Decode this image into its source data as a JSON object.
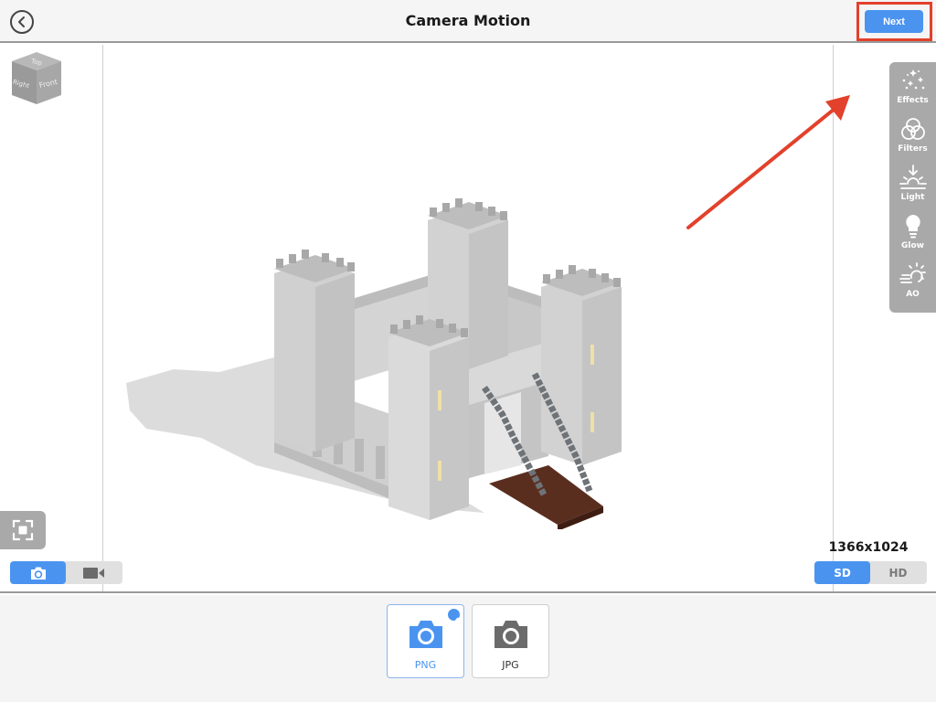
{
  "header": {
    "title": "Camera Motion",
    "back_icon": "chevron-left-circle-icon",
    "next_label": "Next"
  },
  "view_cube": {
    "faces": {
      "top": "Top",
      "right": "Right",
      "front": "Front"
    }
  },
  "tools": [
    {
      "id": "effects",
      "label": "Effects",
      "icon": "sparkles-icon"
    },
    {
      "id": "filters",
      "label": "Filters",
      "icon": "overlapping-circles-icon"
    },
    {
      "id": "light",
      "label": "Light",
      "icon": "sunset-arrow-icon"
    },
    {
      "id": "glow",
      "label": "Glow",
      "icon": "lightbulb-icon"
    },
    {
      "id": "ao",
      "label": "AO",
      "icon": "sun-haze-icon"
    }
  ],
  "capture_mode": {
    "options": [
      {
        "id": "photo",
        "icon": "camera-icon",
        "active": true
      },
      {
        "id": "video",
        "icon": "video-camera-icon",
        "active": false
      }
    ]
  },
  "output": {
    "resolution": "1366x1024",
    "quality_options": [
      {
        "label": "SD",
        "active": true
      },
      {
        "label": "HD",
        "active": false
      }
    ]
  },
  "formats": [
    {
      "label": "PNG",
      "selected": true
    },
    {
      "label": "JPG",
      "selected": false
    }
  ],
  "colors": {
    "accent": "#4a94f0",
    "annotation": "#e2412b",
    "panel_gray": "#a9a9a9"
  }
}
